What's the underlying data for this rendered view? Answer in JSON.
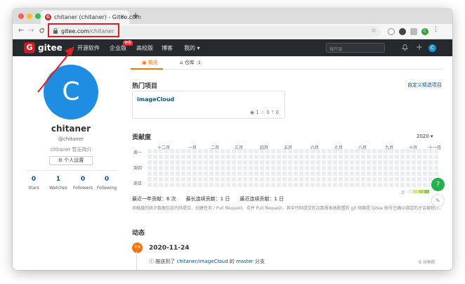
{
  "browser": {
    "tab_title": "chitaner (chitaner) - Gitee.com",
    "tab_close": "×",
    "new_tab": "+",
    "url_host": "gitee.com",
    "url_path": "/chitaner",
    "back": "←",
    "forward": "→",
    "reload": "C",
    "star": "☆",
    "profile_initial": "C"
  },
  "gitee_nav": {
    "logo_letter": "G",
    "brand": "gitee",
    "links": [
      "开源软件",
      "企业版",
      "高校版",
      "博客",
      "我的"
    ],
    "enterprise_badge": "特惠",
    "search_placeholder": "搜开源",
    "bell": "🔔",
    "plus": "+",
    "avatar_initial": "C"
  },
  "profile": {
    "avatar_initial": "C",
    "name": "chitaner",
    "handle": "@chitaner",
    "bio": "chitaner 暂无简介",
    "settings_button": "个人设置",
    "stats": [
      {
        "value": "0",
        "label": "Stars"
      },
      {
        "value": "1",
        "label": "Watches"
      },
      {
        "value": "0",
        "label": "Followers"
      },
      {
        "value": "0",
        "label": "Following"
      }
    ]
  },
  "main": {
    "tabs": [
      {
        "label": "概览"
      },
      {
        "label": "仓库",
        "count": "1"
      }
    ],
    "popular_title": "热门项目",
    "customize_link": "自定义精选项目",
    "repo": {
      "name": "imageCloud",
      "watch": "1",
      "star": "0",
      "fork": "0"
    },
    "contrib_title": "贡献度",
    "year": "2020",
    "months": [
      "十二月",
      "一月",
      "二月",
      "三月",
      "四月",
      "五月",
      "六月",
      "七月",
      "八月",
      "九月",
      "十月",
      "十一月"
    ],
    "weekdays": [
      "周一",
      "周四",
      "周日"
    ],
    "legend_label": "少",
    "summary": "最近一年贡献：6 次　　最长连续贡献：1 日　　最近连续贡献：1 日",
    "note": "贡献度的统计数据包括代码提交、创建任务 / Pull Request、合并 Pull Request，其中代码提交的次数需本地配置的 git 邮箱是 Gitee 帐号已确认绑定的才会被统计。",
    "activity_title": "动态",
    "today_badge": "今天",
    "date": "2020-11-24",
    "activity_prefix": "推送到了",
    "activity_repo": "chitaner/imageCloud",
    "activity_mid": "的",
    "activity_branch": "master",
    "activity_suffix": "分支",
    "activity_time": "9 分钟前"
  },
  "colors": {
    "gitee_red": "#c71d23",
    "accent_orange": "#fe7300",
    "link_blue": "#005980",
    "annotation_red": "#e02020"
  }
}
